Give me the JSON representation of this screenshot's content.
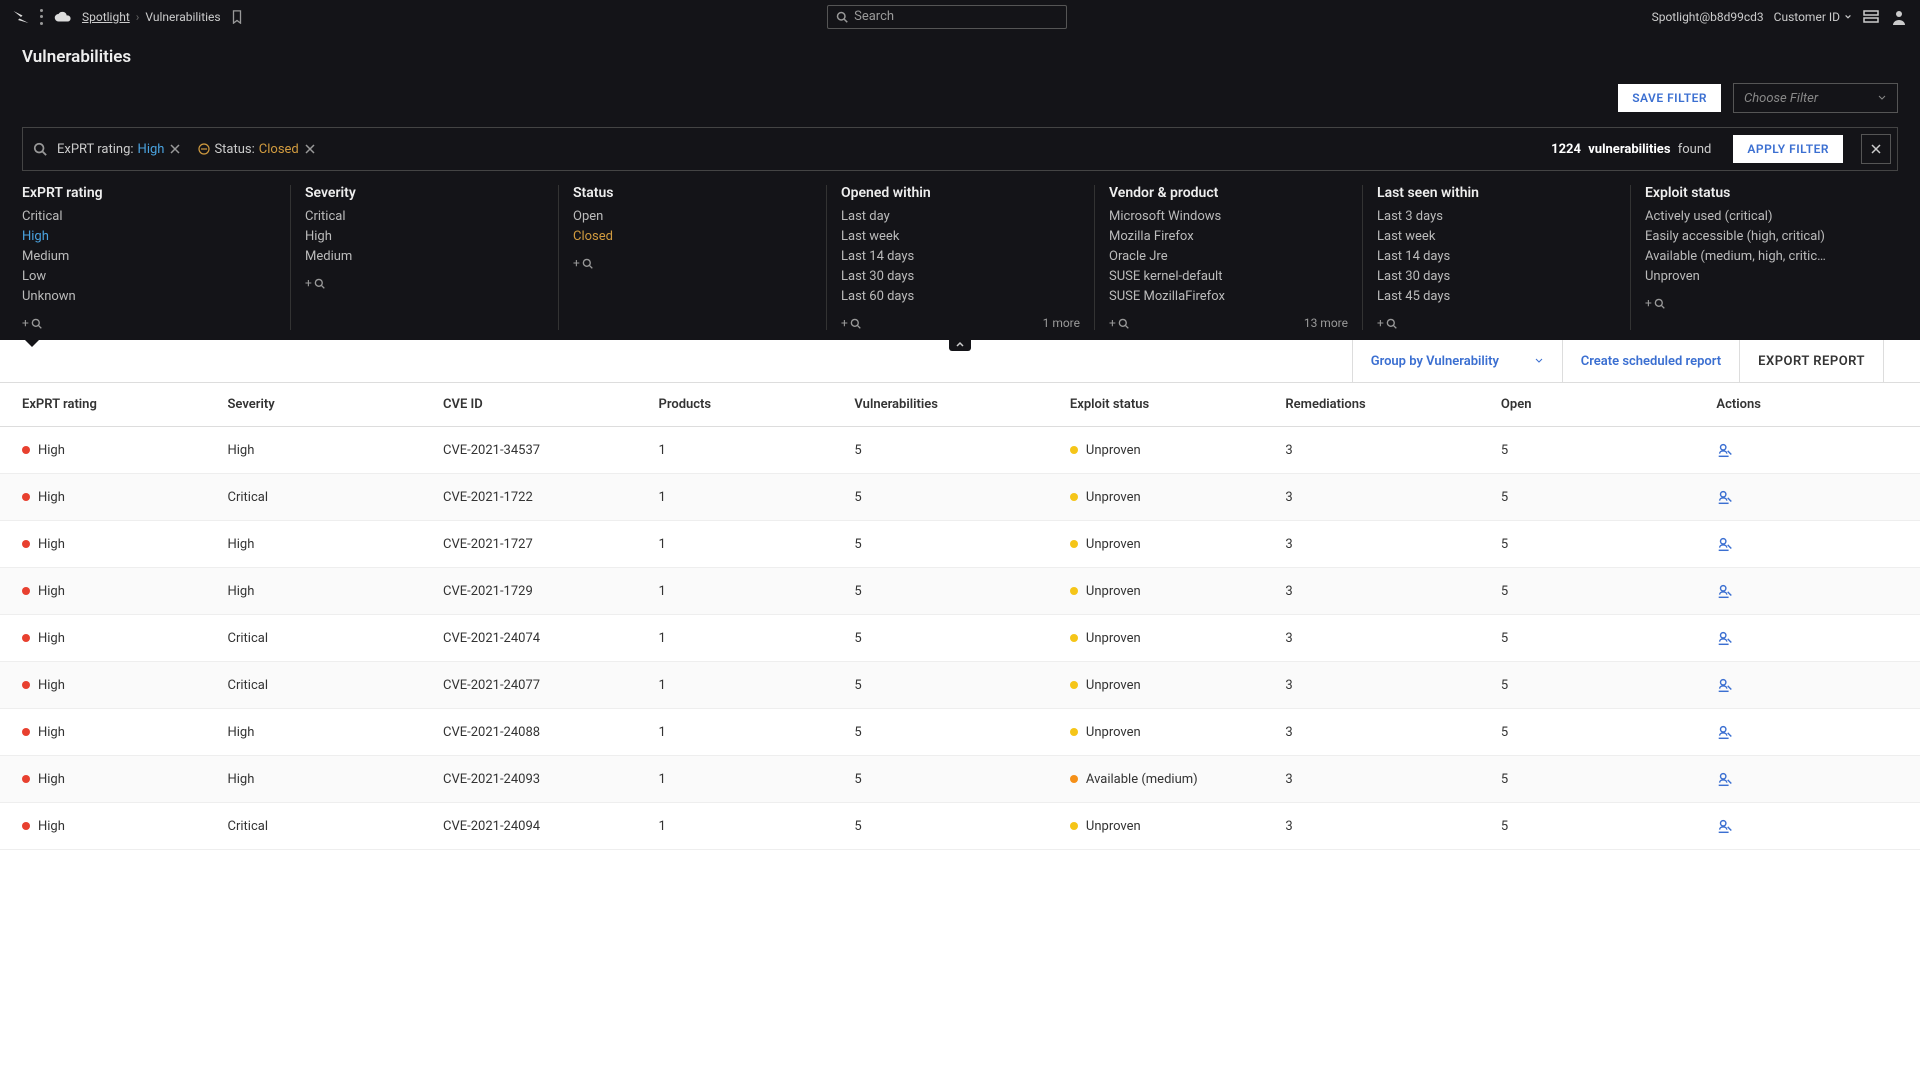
{
  "breadcrumb": {
    "app": "Spotlight",
    "page": "Vulnerabilities"
  },
  "search": {
    "placeholder": "Search"
  },
  "account": {
    "name": "Spotlight@b8d99cd3",
    "customer": "Customer ID"
  },
  "page_title": "Vulnerabilities",
  "buttons": {
    "save_filter": "SAVE FILTER",
    "choose_filter": "Choose Filter",
    "apply_filter": "APPLY FILTER"
  },
  "filter_chips": [
    {
      "label": "ExPRT rating:",
      "value": "High",
      "cls": "val-high"
    },
    {
      "label": "Status:",
      "value": "Closed",
      "cls": "val-closed",
      "warn": true
    }
  ],
  "result": {
    "count": "1224",
    "label": "vulnerabilities",
    "suffix": "found"
  },
  "facets": [
    {
      "title": "ExPRT rating",
      "items": [
        {
          "t": "Critical"
        },
        {
          "t": "High",
          "cls": "sel-blue"
        },
        {
          "t": "Medium"
        },
        {
          "t": "Low"
        },
        {
          "t": "Unknown"
        }
      ]
    },
    {
      "title": "Severity",
      "items": [
        {
          "t": "Critical"
        },
        {
          "t": "High"
        },
        {
          "t": "Medium"
        }
      ]
    },
    {
      "title": "Status",
      "items": [
        {
          "t": "Open"
        },
        {
          "t": "Closed",
          "cls": "sel-gold"
        }
      ]
    },
    {
      "title": "Opened within",
      "items": [
        {
          "t": "Last day"
        },
        {
          "t": "Last week"
        },
        {
          "t": "Last 14 days"
        },
        {
          "t": "Last 30 days"
        },
        {
          "t": "Last 60 days"
        }
      ],
      "more": "1 more"
    },
    {
      "title": "Vendor & product",
      "items": [
        {
          "t": "Microsoft Windows"
        },
        {
          "t": "Mozilla Firefox"
        },
        {
          "t": "Oracle Jre"
        },
        {
          "t": "SUSE kernel-default"
        },
        {
          "t": "SUSE MozillaFirefox"
        }
      ],
      "more": "13 more"
    },
    {
      "title": "Last seen within",
      "items": [
        {
          "t": "Last 3 days"
        },
        {
          "t": "Last week"
        },
        {
          "t": "Last 14 days"
        },
        {
          "t": "Last 30 days"
        },
        {
          "t": "Last 45 days"
        }
      ]
    },
    {
      "title": "Exploit status",
      "items": [
        {
          "t": "Actively used (critical)"
        },
        {
          "t": "Easily accessible (high, critical)"
        },
        {
          "t": "Available (medium, high, critic…"
        },
        {
          "t": "Unproven"
        }
      ]
    }
  ],
  "toolbar": {
    "group_by": "Group by Vulnerability",
    "create_report": "Create scheduled report",
    "export": "EXPORT REPORT"
  },
  "columns": [
    "ExPRT rating",
    "Severity",
    "CVE ID",
    "Products",
    "Vulnerabilities",
    "Exploit status",
    "Remediations",
    "Open",
    "Actions"
  ],
  "rows": [
    {
      "exprt": "High",
      "sev": "High",
      "cve": "CVE-2021-34537",
      "prod": "1",
      "vuln": "5",
      "exp": "Unproven",
      "expdot": "dot-yellow",
      "rem": "3",
      "open": "5"
    },
    {
      "exprt": "High",
      "sev": "Critical",
      "cve": "CVE-2021-1722",
      "prod": "1",
      "vuln": "5",
      "exp": "Unproven",
      "expdot": "dot-yellow",
      "rem": "3",
      "open": "5"
    },
    {
      "exprt": "High",
      "sev": "High",
      "cve": "CVE-2021-1727",
      "prod": "1",
      "vuln": "5",
      "exp": "Unproven",
      "expdot": "dot-yellow",
      "rem": "3",
      "open": "5"
    },
    {
      "exprt": "High",
      "sev": "High",
      "cve": "CVE-2021-1729",
      "prod": "1",
      "vuln": "5",
      "exp": "Unproven",
      "expdot": "dot-yellow",
      "rem": "3",
      "open": "5"
    },
    {
      "exprt": "High",
      "sev": "Critical",
      "cve": "CVE-2021-24074",
      "prod": "1",
      "vuln": "5",
      "exp": "Unproven",
      "expdot": "dot-yellow",
      "rem": "3",
      "open": "5"
    },
    {
      "exprt": "High",
      "sev": "Critical",
      "cve": "CVE-2021-24077",
      "prod": "1",
      "vuln": "5",
      "exp": "Unproven",
      "expdot": "dot-yellow",
      "rem": "3",
      "open": "5"
    },
    {
      "exprt": "High",
      "sev": "High",
      "cve": "CVE-2021-24088",
      "prod": "1",
      "vuln": "5",
      "exp": "Unproven",
      "expdot": "dot-yellow",
      "rem": "3",
      "open": "5"
    },
    {
      "exprt": "High",
      "sev": "High",
      "cve": "CVE-2021-24093",
      "prod": "1",
      "vuln": "5",
      "exp": "Available (medium)",
      "expdot": "dot-orange",
      "rem": "3",
      "open": "5"
    },
    {
      "exprt": "High",
      "sev": "Critical",
      "cve": "CVE-2021-24094",
      "prod": "1",
      "vuln": "5",
      "exp": "Unproven",
      "expdot": "dot-yellow",
      "rem": "3",
      "open": "5"
    }
  ]
}
